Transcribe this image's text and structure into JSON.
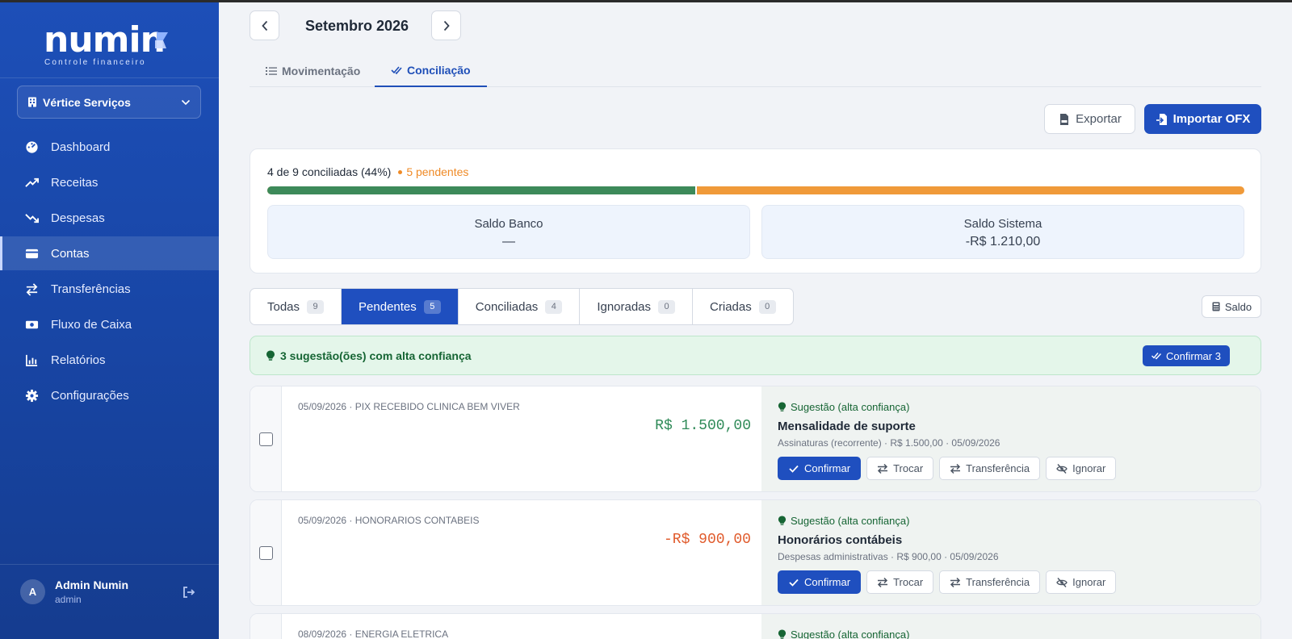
{
  "app": {
    "logo_text": "numin",
    "logo_subtitle": "Controle financeiro",
    "company": "Vértice Serviços"
  },
  "sidebar": {
    "items": [
      {
        "label": "Dashboard",
        "icon": "dashboard-icon"
      },
      {
        "label": "Receitas",
        "icon": "trending-up-icon"
      },
      {
        "label": "Despesas",
        "icon": "trending-down-icon"
      },
      {
        "label": "Contas",
        "icon": "wallet-icon",
        "active": true
      },
      {
        "label": "Transferências",
        "icon": "transfer-icon"
      },
      {
        "label": "Fluxo de Caixa",
        "icon": "cash-flow-icon"
      },
      {
        "label": "Relatórios",
        "icon": "chart-icon"
      },
      {
        "label": "Configurações",
        "icon": "gear-icon"
      }
    ],
    "user": {
      "initial": "A",
      "name": "Admin Numin",
      "role": "admin"
    }
  },
  "header": {
    "month": "Setembro 2026",
    "tabs": [
      {
        "label": "Movimentação",
        "active": false
      },
      {
        "label": "Conciliação",
        "active": true
      }
    ],
    "export_label": "Exportar",
    "import_label": "Importar OFX"
  },
  "summary": {
    "reconciled_text": "4 de 9 conciliadas (44%)",
    "pending_text": "5 pendentes",
    "progress": 0.44,
    "bank_label": "Saldo Banco",
    "bank_value": "—",
    "system_label": "Saldo Sistema",
    "system_value": "-R$ 1.210,00"
  },
  "filters": [
    {
      "label": "Todas",
      "count": "9",
      "active": false
    },
    {
      "label": "Pendentes",
      "count": "5",
      "active": true
    },
    {
      "label": "Conciliadas",
      "count": "4",
      "active": false
    },
    {
      "label": "Ignoradas",
      "count": "0",
      "active": false
    },
    {
      "label": "Criadas",
      "count": "0",
      "active": false
    }
  ],
  "saldo_label": "Saldo",
  "banner": {
    "text": "3 sugestão(ões) com alta confiança",
    "button": "Confirmar 3"
  },
  "transactions": [
    {
      "desc": "05/09/2026 · PIX RECEBIDO CLINICA BEM VIVER",
      "amount": "R$ 1.500,00",
      "suggestion_head": "Sugestão (alta confiança)",
      "suggestion_title": "Mensalidade de suporte",
      "suggestion_sub": "Assinaturas (recorrente) · R$ 1.500,00 · 05/09/2026"
    },
    {
      "desc": "05/09/2026 · HONORARIOS CONTABEIS",
      "amount": "-R$ 900,00",
      "suggestion_head": "Sugestão (alta confiança)",
      "suggestion_title": "Honorários contábeis",
      "suggestion_sub": "Despesas administrativas · R$ 900,00 · 05/09/2026"
    },
    {
      "desc": "08/09/2026 · ENERGIA ELETRICA",
      "suggestion_head": "Sugestão (alta confiança)"
    }
  ],
  "actions": {
    "confirm": "Confirmar",
    "swap": "Trocar",
    "transfer": "Transferência",
    "ignore": "Ignorar"
  },
  "colors": {
    "sidebar": "#1d4fb8",
    "primary": "#1f4fbf",
    "reconciled": "#3d8a5a",
    "pending": "#f09a39",
    "positive": "#2f8a58",
    "negative": "#e05a2b"
  }
}
